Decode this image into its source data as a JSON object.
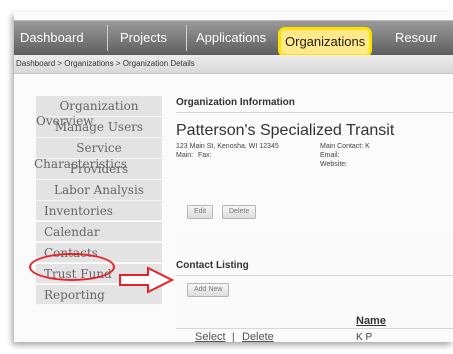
{
  "topnav": {
    "tabs": [
      "Dashboard",
      "Projects",
      "Applications",
      "Organizations",
      "Resour"
    ],
    "active_tab": "Organizations",
    "highlight_color": "#ffe100"
  },
  "breadcrumb": "Dashboard > Organizations > Organization Details",
  "sidebar": {
    "items": [
      "Organization",
      "Manage Users",
      "Service",
      "Providers",
      "Labor Analysis",
      "Inventories",
      "Calendar",
      "Contacts",
      "Trust Fund",
      "Reporting"
    ],
    "overlay_items": [
      "Overview",
      "Characteristics"
    ],
    "circled_item": "Contacts",
    "annotation_color": "#e8202a"
  },
  "org_info": {
    "section_title": "Organization Information",
    "name": "Patterson's Specialized Transit",
    "address": "123 Main St, Kenosha, WI 12345",
    "main_label": "Main:",
    "fax_label": "Fax:",
    "main_contact_label": "Main Contact: K",
    "email_label": "Email:",
    "website_label": "Website:",
    "edit_button": "Edit",
    "delete_button": "Delete"
  },
  "contact_listing": {
    "section_title": "Contact Listing",
    "add_button": "Add New",
    "columns": [
      "Name"
    ],
    "rows": [
      {
        "select": "Select",
        "divider": "|",
        "delete": "Delete",
        "name": "K P"
      }
    ]
  }
}
